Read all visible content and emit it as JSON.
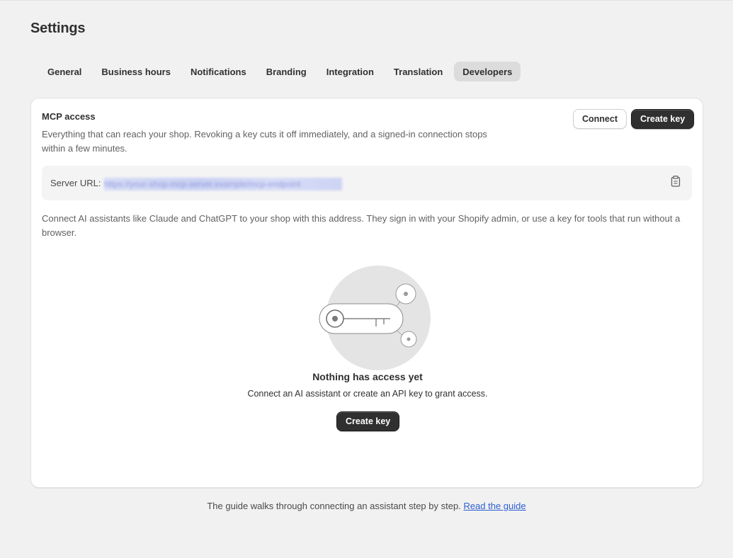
{
  "page": {
    "title": "Settings"
  },
  "tabs": [
    {
      "label": "General",
      "active": false
    },
    {
      "label": "Business hours",
      "active": false
    },
    {
      "label": "Notifications",
      "active": false
    },
    {
      "label": "Branding",
      "active": false
    },
    {
      "label": "Integration",
      "active": false
    },
    {
      "label": "Translation",
      "active": false
    },
    {
      "label": "Developers",
      "active": true
    }
  ],
  "mcp": {
    "title": "MCP access",
    "description": "Everything that can reach your shop. Revoking a key cuts it off immediately, and a signed-in connection stops within a few minutes.",
    "connect_label": "Connect",
    "create_key_label": "Create key",
    "server_url_label": "Server URL:",
    "server_url_value": "https://your-shop-mcp-server.example/mcp-endpoint",
    "help_text": "Connect AI assistants like Claude and ChatGPT to your shop with this address. They sign in with your Shopify admin, or use a key for tools that run without a browser."
  },
  "empty_state": {
    "title": "Nothing has access yet",
    "description": "Connect an AI assistant or create an API key to grant access.",
    "button_label": "Create key"
  },
  "footer": {
    "text": "The guide walks through connecting an assistant step by step.",
    "link_label": "Read the guide"
  },
  "colors": {
    "background": "#f1f1f1",
    "primary_button": "#303030",
    "link": "#2c5ed1"
  },
  "icons": {
    "copy": "clipboard-icon",
    "illustration": "key-illustration"
  }
}
